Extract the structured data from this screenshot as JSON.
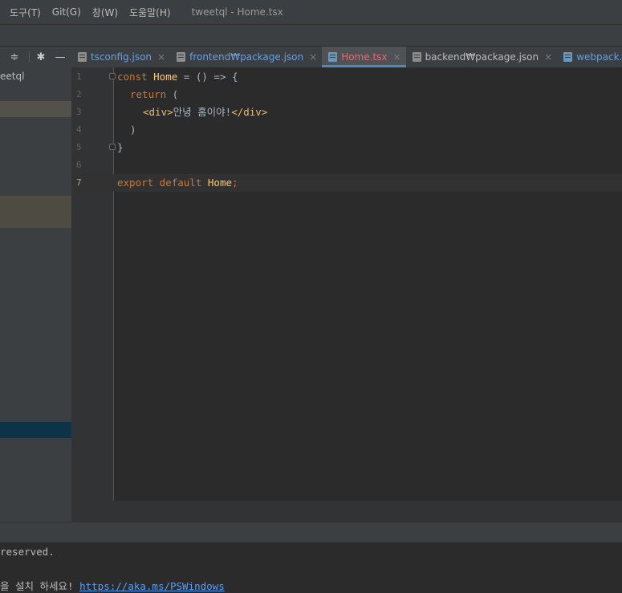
{
  "menu": {
    "items": [
      "도구(T)",
      "Git(G)",
      "창(W)",
      "도움말(H)"
    ],
    "window_title": "tweetql - Home.tsx"
  },
  "project_panel": {
    "root_label": "eetql",
    "icons": [
      "collapse-icon",
      "gear-icon",
      "minimize-icon"
    ]
  },
  "tabs": [
    {
      "label": "tsconfig.json",
      "style": "link"
    },
    {
      "label": "frontend₩package.json",
      "style": "link"
    },
    {
      "label": "Home.tsx",
      "style": "error",
      "active": true
    },
    {
      "label": "backend₩package.json",
      "style": "plain"
    },
    {
      "label": "webpack.config.ts",
      "style": "link"
    }
  ],
  "editor": {
    "line_numbers": [
      "1",
      "2",
      "3",
      "4",
      "5",
      "6",
      "7"
    ],
    "current_line": 7,
    "lines": {
      "l1": {
        "kw": "const ",
        "fn": "Home",
        "rest": " = () => {"
      },
      "l2": {
        "kw": "return",
        "rest": " ("
      },
      "l3": {
        "tag_open": "<div>",
        "text": "안녕 홈이야!",
        "tag_close": "</div>"
      },
      "l4": {
        "rest": ")"
      },
      "l5": {
        "rest": "}"
      },
      "l6": {
        "rest": ""
      },
      "l7": {
        "kw": "export default ",
        "fn": "Home",
        "rest": ";"
      }
    }
  },
  "terminal": {
    "line1": "reserved.",
    "line2_text": "을 설치 하세요! ",
    "line2_link": "https://aka.ms/PSWindows"
  },
  "colors": {
    "keyword": "#cc7832",
    "function": "#ffc66d",
    "tag": "#e8bf6a",
    "active_tab_underline": "#4a88c7",
    "error_tab": "#e06c75"
  }
}
